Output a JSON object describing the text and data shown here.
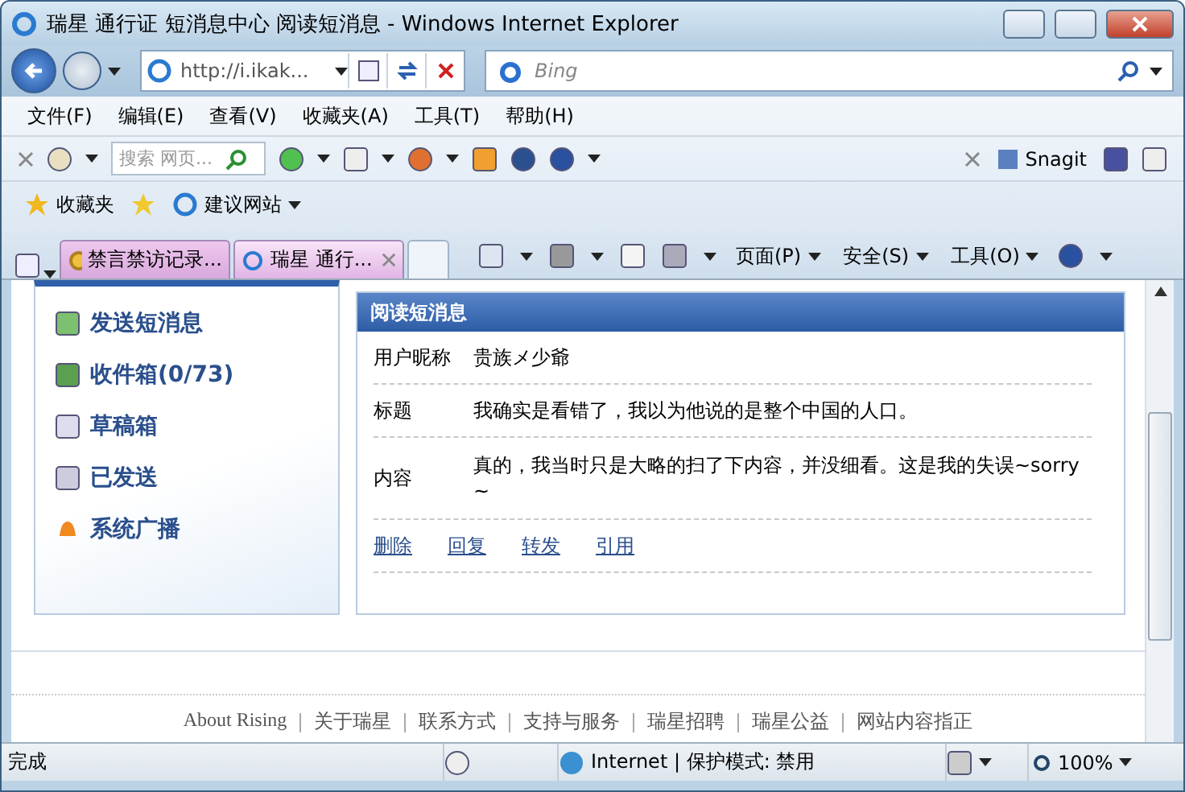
{
  "window": {
    "title": "瑞星 通行证 短消息中心 阅读短消息 - Windows Internet Explorer"
  },
  "nav": {
    "address": "http://i.ikak...",
    "search_placeholder": "Bing"
  },
  "menu": [
    "文件(F)",
    "编辑(E)",
    "查看(V)",
    "收藏夹(A)",
    "工具(T)",
    "帮助(H)"
  ],
  "toolbar": {
    "search_placeholder": "搜索 网页...",
    "snagit": "Snagit"
  },
  "favorites": {
    "label": "收藏夹",
    "suggested": "建议网站"
  },
  "tabs": [
    {
      "label": "禁言禁访记录...",
      "selected": false
    },
    {
      "label": "瑞星 通行...",
      "selected": true
    }
  ],
  "commands": [
    "页面(P)",
    "安全(S)",
    "工具(O)"
  ],
  "sidebar": {
    "items": [
      {
        "label": "发送短消息",
        "kind": "send"
      },
      {
        "label": "收件箱(0/73)",
        "kind": "inbox"
      },
      {
        "label": "草稿箱",
        "kind": "drafts"
      },
      {
        "label": "已发送",
        "kind": "sent"
      },
      {
        "label": "系统广播",
        "kind": "broadcast"
      }
    ]
  },
  "message": {
    "title": "阅读短消息",
    "fields": [
      {
        "label": "用户昵称",
        "value": "贵族メ少爺"
      },
      {
        "label": "标题",
        "value": "我确实是看错了，我以为他说的是整个中国的人口。"
      },
      {
        "label": "内容",
        "value": "真的，我当时只是大略的扫了下内容，并没细看。这是我的失误~sorry ~"
      }
    ],
    "actions": [
      "删除",
      "回复",
      "转发",
      "引用"
    ]
  },
  "footer": {
    "links": [
      "About  Rising",
      "关于瑞星",
      "联系方式",
      "支持与服务",
      "瑞星招聘",
      "瑞星公益",
      "网站内容指正"
    ]
  },
  "status": {
    "text": "完成",
    "zone": "Internet | 保护模式: 禁用",
    "zoom": "100%"
  }
}
